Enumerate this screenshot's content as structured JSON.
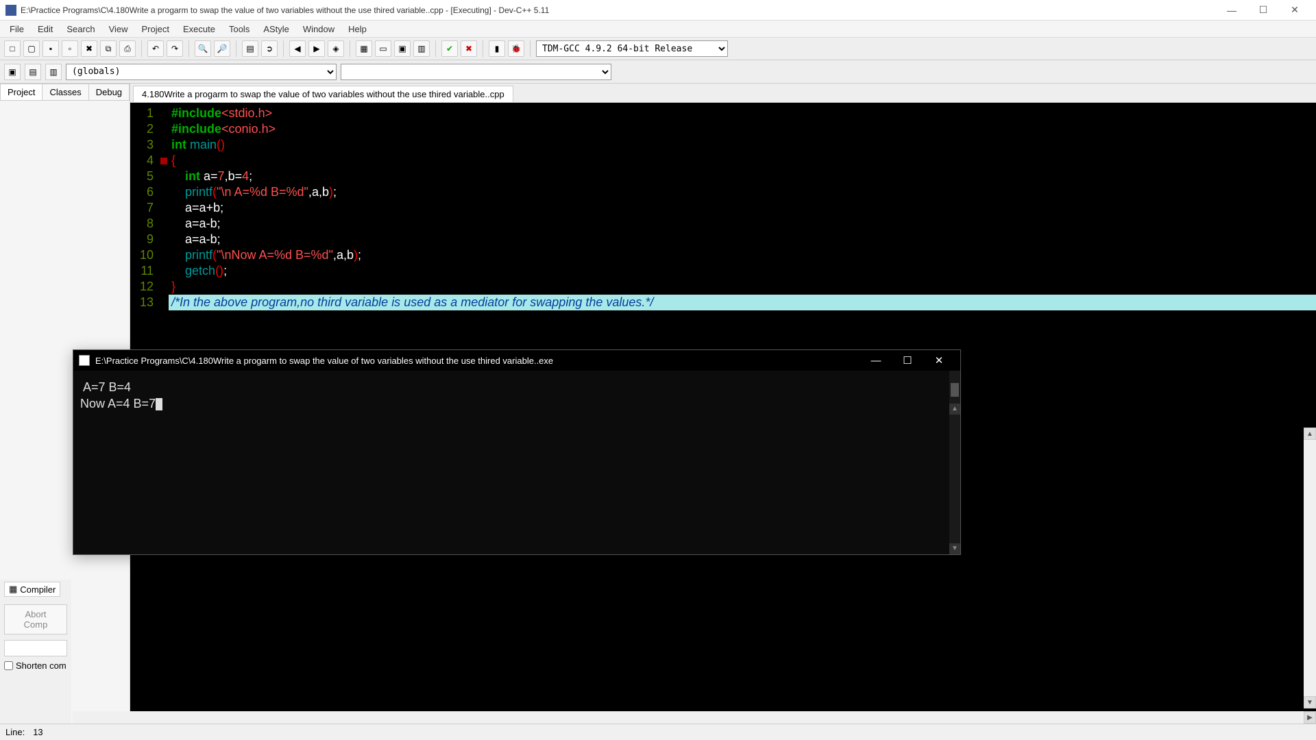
{
  "window": {
    "title": "E:\\Practice Programs\\C\\4.180Write a progarm to swap the value of two variables without the use thired variable..cpp - [Executing] - Dev-C++ 5.11"
  },
  "menu": [
    "File",
    "Edit",
    "Search",
    "View",
    "Project",
    "Execute",
    "Tools",
    "AStyle",
    "Window",
    "Help"
  ],
  "compiler_select": "TDM-GCC 4.9.2 64-bit Release",
  "scope_select": "(globals)",
  "sidebar": {
    "tabs": [
      "Project",
      "Classes",
      "Debug"
    ],
    "active": 0
  },
  "file_tab": "4.180Write a progarm to swap the value of two variables without the use thired variable..cpp",
  "code": {
    "lines": [
      {
        "n": 1,
        "tokens": [
          {
            "t": "inc",
            "v": "#include"
          },
          {
            "t": "hdr",
            "v": "<stdio.h>"
          }
        ]
      },
      {
        "n": 2,
        "tokens": [
          {
            "t": "inc",
            "v": "#include"
          },
          {
            "t": "hdr",
            "v": "<conio.h>"
          }
        ]
      },
      {
        "n": 3,
        "tokens": [
          {
            "t": "kw",
            "v": "int "
          },
          {
            "t": "fn",
            "v": "main"
          },
          {
            "t": "br",
            "v": "()"
          }
        ]
      },
      {
        "n": 4,
        "fold": true,
        "tokens": [
          {
            "t": "br",
            "v": "{"
          }
        ]
      },
      {
        "n": 5,
        "tokens": [
          {
            "t": "pad",
            "v": "    "
          },
          {
            "t": "kw",
            "v": "int "
          },
          {
            "t": "id",
            "v": "a"
          },
          {
            "t": "op",
            "v": "="
          },
          {
            "t": "num",
            "v": "7"
          },
          {
            "t": "op",
            "v": ","
          },
          {
            "t": "id",
            "v": "b"
          },
          {
            "t": "op",
            "v": "="
          },
          {
            "t": "num",
            "v": "4"
          },
          {
            "t": "op",
            "v": ";"
          }
        ]
      },
      {
        "n": 6,
        "tokens": [
          {
            "t": "pad",
            "v": "    "
          },
          {
            "t": "fn",
            "v": "printf"
          },
          {
            "t": "br",
            "v": "("
          },
          {
            "t": "str",
            "v": "\"\\n A=%d B=%d\""
          },
          {
            "t": "op",
            "v": ","
          },
          {
            "t": "id",
            "v": "a"
          },
          {
            "t": "op",
            "v": ","
          },
          {
            "t": "id",
            "v": "b"
          },
          {
            "t": "br",
            "v": ")"
          },
          {
            "t": "op",
            "v": ";"
          }
        ]
      },
      {
        "n": 7,
        "tokens": [
          {
            "t": "pad",
            "v": "    "
          },
          {
            "t": "id",
            "v": "a"
          },
          {
            "t": "op",
            "v": "="
          },
          {
            "t": "id",
            "v": "a"
          },
          {
            "t": "op",
            "v": "+"
          },
          {
            "t": "id",
            "v": "b"
          },
          {
            "t": "op",
            "v": ";"
          }
        ]
      },
      {
        "n": 8,
        "tokens": [
          {
            "t": "pad",
            "v": "    "
          },
          {
            "t": "id",
            "v": "a"
          },
          {
            "t": "op",
            "v": "="
          },
          {
            "t": "id",
            "v": "a"
          },
          {
            "t": "op",
            "v": "-"
          },
          {
            "t": "id",
            "v": "b"
          },
          {
            "t": "op",
            "v": ";"
          }
        ]
      },
      {
        "n": 9,
        "tokens": [
          {
            "t": "pad",
            "v": "    "
          },
          {
            "t": "id",
            "v": "a"
          },
          {
            "t": "op",
            "v": "="
          },
          {
            "t": "id",
            "v": "a"
          },
          {
            "t": "op",
            "v": "-"
          },
          {
            "t": "id",
            "v": "b"
          },
          {
            "t": "op",
            "v": ";"
          }
        ]
      },
      {
        "n": 10,
        "tokens": [
          {
            "t": "pad",
            "v": "    "
          },
          {
            "t": "fn",
            "v": "printf"
          },
          {
            "t": "br",
            "v": "("
          },
          {
            "t": "str",
            "v": "\"\\nNow A=%d B=%d\""
          },
          {
            "t": "op",
            "v": ","
          },
          {
            "t": "id",
            "v": "a"
          },
          {
            "t": "op",
            "v": ","
          },
          {
            "t": "id",
            "v": "b"
          },
          {
            "t": "br",
            "v": ")"
          },
          {
            "t": "op",
            "v": ";"
          }
        ]
      },
      {
        "n": 11,
        "tokens": [
          {
            "t": "pad",
            "v": "    "
          },
          {
            "t": "fn",
            "v": "getch"
          },
          {
            "t": "br",
            "v": "()"
          },
          {
            "t": "op",
            "v": ";"
          }
        ]
      },
      {
        "n": 12,
        "tokens": [
          {
            "t": "br",
            "v": "}"
          }
        ]
      },
      {
        "n": 13,
        "hl": true,
        "tokens": [
          {
            "t": "comment",
            "v": "/*In the above program,no third variable is used as a mediator for swapping the values.*/"
          }
        ]
      }
    ]
  },
  "bottom": {
    "tab_label": "Compiler",
    "abort_label": "Abort Comp",
    "shorten_label": "Shorten com"
  },
  "console": {
    "title": "E:\\Practice Programs\\C\\4.180Write a progarm to swap the value of two variables without the use thired variable..exe",
    "line1": " A=7 B=4",
    "line2": "Now A=4 B=7"
  },
  "status": {
    "line_label": "Line:",
    "line_value": "13"
  },
  "icons": {
    "new": "□",
    "open": "▢",
    "save": "▪",
    "saveall": "▫",
    "close": "✖",
    "closeall": "⧉",
    "print": "⎙",
    "undo": "↶",
    "redo": "↷",
    "find": "🔍",
    "findall": "🔎",
    "toggle": "▤",
    "goto": "➲",
    "back": "◀",
    "fwd": "▶",
    "bookmark": "◈",
    "g1": "▦",
    "g2": "▭",
    "g3": "▣",
    "g4": "▥",
    "check": "✔",
    "err": "✖",
    "chart": "▮",
    "bug": "🐞"
  }
}
